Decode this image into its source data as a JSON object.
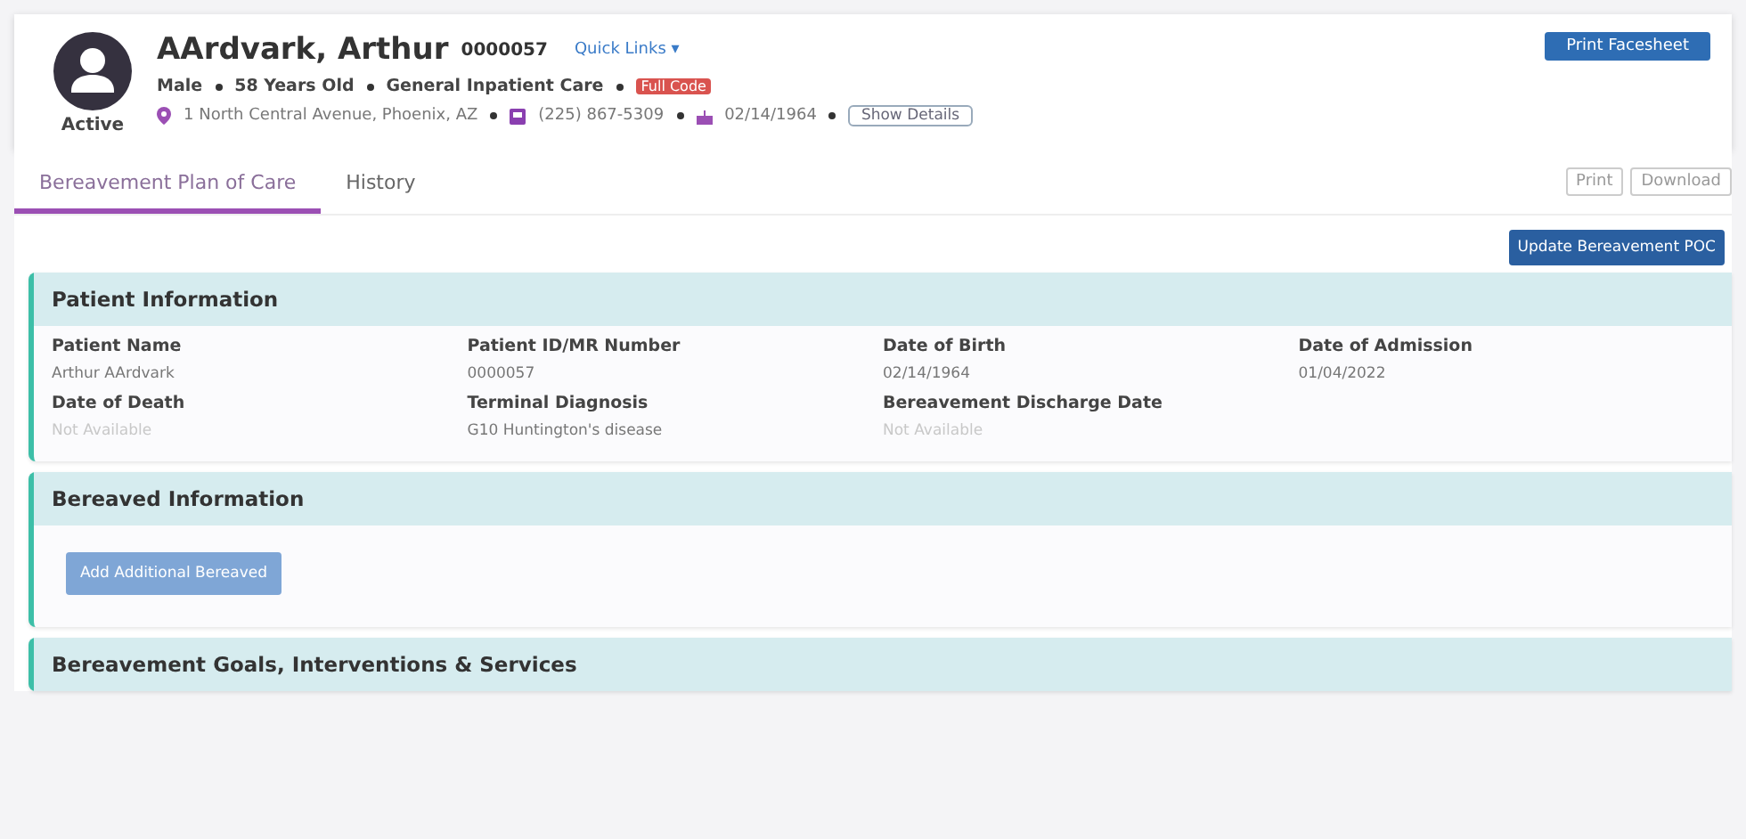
{
  "patient": {
    "name": "AArdvark, Arthur",
    "id": "0000057",
    "quick_links": "Quick Links ▾",
    "status": "Active",
    "details": [
      "Male",
      "58 Years Old",
      "General Inpatient Care"
    ],
    "badge": "Full Code",
    "address": "1 North Central Avenue, Phoenix, AZ",
    "phone": "(225) 867-5309",
    "birth_date": "02/14/1964",
    "show_details": "Show Details",
    "print_button": "Print Facesheet"
  },
  "tabs": [
    {
      "label": "Bereavement Plan of Care",
      "selected": true
    },
    {
      "label": "History",
      "selected": false
    }
  ],
  "tab_actions": [
    "Print",
    "Download"
  ],
  "update_button": "Update Bereavement POC",
  "sections": [
    {
      "kind": "fields",
      "title": "Patient Information",
      "fields": [
        {
          "label": "Patient Name",
          "value": "Arthur AArdvark",
          "available": true
        },
        {
          "label": "Patient ID/MR Number",
          "value": "0000057",
          "available": true
        },
        {
          "label": "Date of Birth",
          "value": "02/14/1964",
          "available": true
        },
        {
          "label": "Date of Admission",
          "value": "01/04/2022",
          "available": true
        },
        {
          "label": "Date of Death",
          "value": "Not Available",
          "available": false
        },
        {
          "label": "Terminal Diagnosis",
          "value": "G10 Huntington's disease",
          "available": true
        },
        {
          "label": "Bereavement Discharge Date",
          "value": "Not Available",
          "available": false
        }
      ]
    },
    {
      "kind": "button",
      "title": "Bereaved Information",
      "button": "Add Additional Bereaved"
    },
    {
      "kind": "header",
      "title": "Bereavement Goals, Interventions & Services"
    }
  ]
}
